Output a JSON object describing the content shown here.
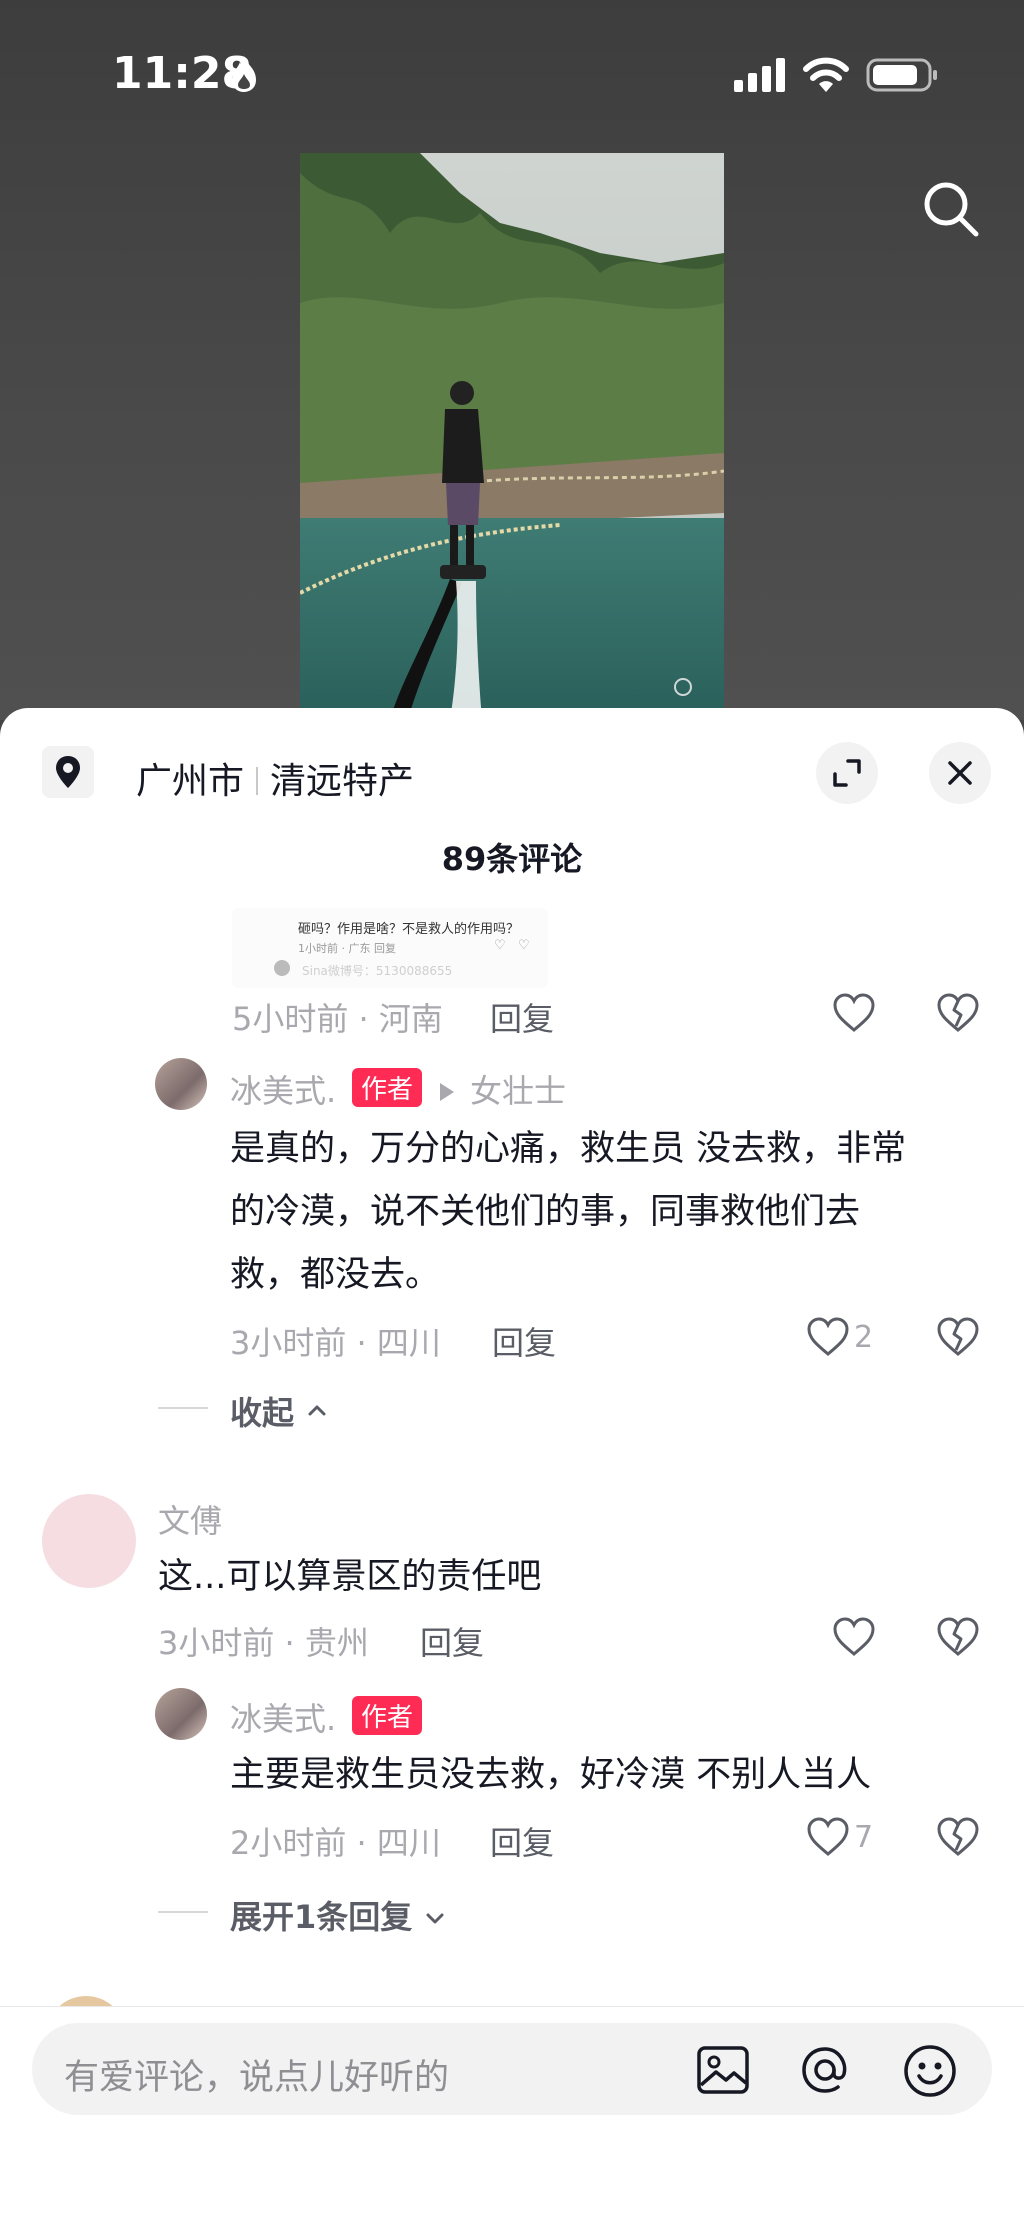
{
  "status_bar": {
    "time": "11:28"
  },
  "location": {
    "city": "广州市",
    "place": "清远特产"
  },
  "comments_header": {
    "count_label": "89条评论"
  },
  "quoted_screenshot": {
    "text": "砸吗？作用是啥？不是救人的作用吗？",
    "meta": "1小时前 · 广东    回复",
    "footer": "Sina微博号：5130088655"
  },
  "comment_top": {
    "meta": "5小时前 · 河南",
    "reply": "回复"
  },
  "reply_1": {
    "username": "冰美式.",
    "badge": "作者",
    "reply_to": "女壮士",
    "text_line1": "是真的，万分的心痛，救生员 没去救，非常",
    "text_line2": "的冷漠，说不关他们的事，同事救他们去",
    "text_line3": "救，都没去。",
    "meta": "3小时前 · 四川",
    "reply": "回复",
    "likes": "2"
  },
  "collapse_label": "收起",
  "comment_2": {
    "username": "文傅",
    "text": "这...可以算景区的责任吧",
    "meta": "3小时前 · 贵州",
    "reply": "回复"
  },
  "reply_2": {
    "username": "冰美式.",
    "badge": "作者",
    "text": "主要是救生员没去救，好冷漠 不别人当人",
    "meta": "2小时前 · 四川",
    "reply": "回复",
    "likes": "7"
  },
  "expand_label": "展开1条回复",
  "input": {
    "placeholder": "有爱评论，说点儿好听的"
  },
  "colors": {
    "author_badge": "#fe2c55",
    "text_primary": "#161823",
    "text_secondary": "#a8a8ae"
  }
}
